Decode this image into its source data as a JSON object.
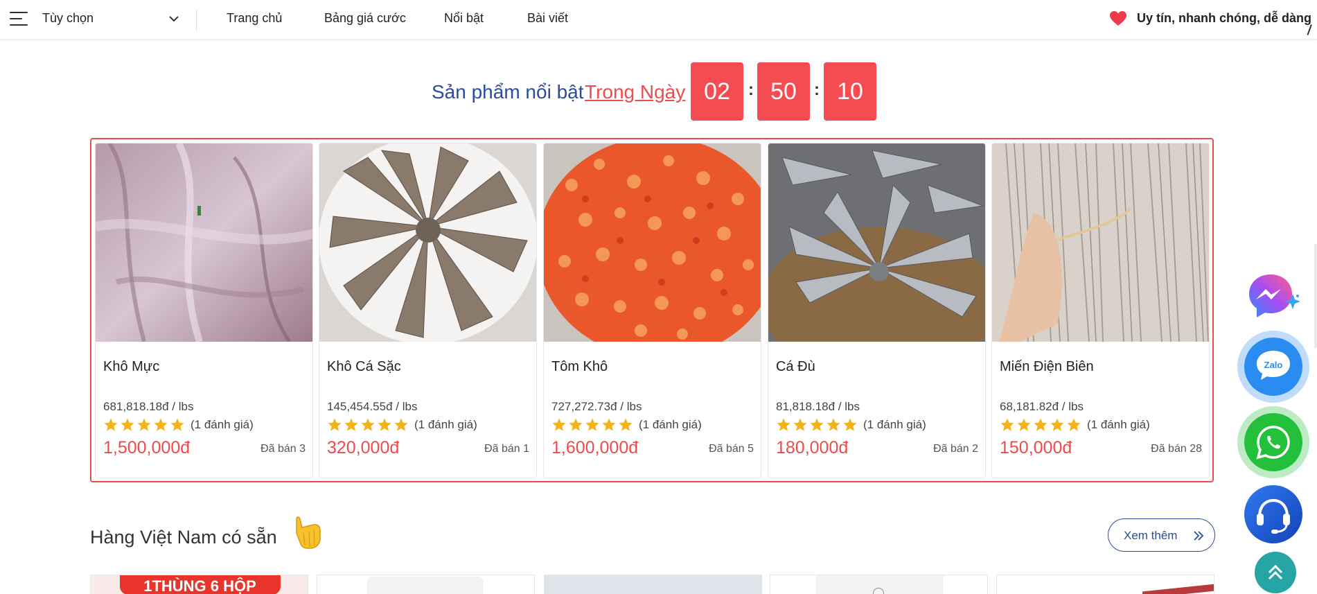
{
  "nav": {
    "select_label": "Tùy chọn",
    "links": [
      "Trang chủ",
      "Bảng giá cước",
      "Nổi bật",
      "Bài viết"
    ],
    "tagline": "Uy tín, nhanh chóng, dễ dàng"
  },
  "featured": {
    "heading": "Sản phẩm nổi bật",
    "highlight": "Trong Ngày",
    "countdown": {
      "hours": "02",
      "minutes": "50",
      "seconds": "10",
      "separator": ":"
    }
  },
  "products": [
    {
      "name": "Khô Mực",
      "unit_price": "681,818.18đ / lbs",
      "rating": 5,
      "reviews": "(1 đánh giá)",
      "price": "1,500,000đ",
      "sold": "Đã bán 3",
      "image": "dried-squid"
    },
    {
      "name": "Khô Cá Sặc",
      "unit_price": "145,454.55đ / lbs",
      "rating": 5,
      "reviews": "(1 đánh giá)",
      "price": "320,000đ",
      "sold": "Đã bán 1",
      "image": "dried-snakeskin-gourami"
    },
    {
      "name": "Tôm Khô",
      "unit_price": "727,272.73đ / lbs",
      "rating": 5,
      "reviews": "(1 đánh giá)",
      "price": "1,600,000đ",
      "sold": "Đã bán 5",
      "image": "dried-shrimp"
    },
    {
      "name": "Cá Đù",
      "unit_price": "81,818.18đ / lbs",
      "rating": 5,
      "reviews": "(1 đánh giá)",
      "price": "180,000đ",
      "sold": "Đã bán 2",
      "image": "dried-croaker"
    },
    {
      "name": "Miến Điện Biên",
      "unit_price": "68,181.82đ / lbs",
      "rating": 5,
      "reviews": "(1 đánh giá)",
      "price": "150,000đ",
      "sold": "Đã bán 28",
      "image": "dien-bien-glass-noodles"
    }
  ],
  "section2": {
    "title": "Hàng Việt Nam có sẵn",
    "emoji_icon": "pointing-down-icon",
    "more_label": "Xem thêm",
    "first_thumb_text": "1THÙNG 6 HỘP"
  },
  "floating": [
    "messenger-icon",
    "zalo-icon",
    "whatsapp-icon",
    "support-headset-icon",
    "back-to-top-icon"
  ],
  "colors": {
    "accent_red": "#ef4a4a",
    "heading_blue": "#2a4c9a",
    "star_gold": "#f5b21b",
    "zalo_blue": "#2a8cf0",
    "whatsapp_green": "#25c03b",
    "support_blue": "#1a5fd8",
    "top_teal": "#27a4a4"
  }
}
